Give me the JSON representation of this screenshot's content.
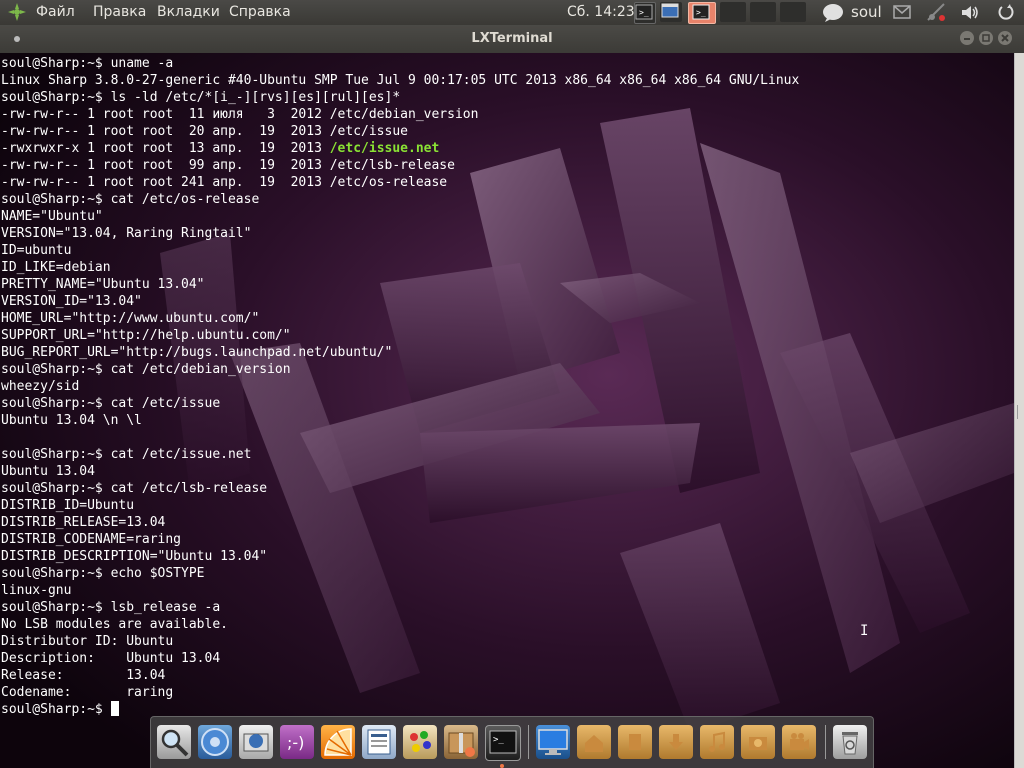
{
  "top_panel": {
    "menu": [
      "Файл",
      "Правка",
      "Вкладки",
      "Справка"
    ],
    "clock": "Сб. 14:23",
    "user": "soul"
  },
  "window": {
    "title": "LXTerminal"
  },
  "terminal": {
    "lines": [
      "soul@Sharp:~$ uname -a",
      "Linux Sharp 3.8.0-27-generic #40-Ubuntu SMP Tue Jul 9 00:17:05 UTC 2013 x86_64 x86_64 x86_64 GNU/Linux",
      "soul@Sharp:~$ ls -ld /etc/*[i_-][rvs][es][rul][es]*",
      "-rw-rw-r-- 1 root root  11 июля   3  2012 /etc/debian_version",
      "-rw-rw-r-- 1 root root  20 апр.  19  2013 /etc/issue",
      "-rwxrwxr-x 1 root root  13 апр.  19  2013 ",
      "-rw-rw-r-- 1 root root  99 апр.  19  2013 /etc/lsb-release",
      "-rw-rw-r-- 1 root root 241 апр.  19  2013 /etc/os-release",
      "soul@Sharp:~$ cat /etc/os-release",
      "NAME=\"Ubuntu\"",
      "VERSION=\"13.04, Raring Ringtail\"",
      "ID=ubuntu",
      "ID_LIKE=debian",
      "PRETTY_NAME=\"Ubuntu 13.04\"",
      "VERSION_ID=\"13.04\"",
      "HOME_URL=\"http://www.ubuntu.com/\"",
      "SUPPORT_URL=\"http://help.ubuntu.com/\"",
      "BUG_REPORT_URL=\"http://bugs.launchpad.net/ubuntu/\"",
      "soul@Sharp:~$ cat /etc/debian_version",
      "wheezy/sid",
      "soul@Sharp:~$ cat /etc/issue",
      "Ubuntu 13.04 \\n \\l",
      "",
      "soul@Sharp:~$ cat /etc/issue.net",
      "Ubuntu 13.04",
      "soul@Sharp:~$ cat /etc/lsb-release",
      "DISTRIB_ID=Ubuntu",
      "DISTRIB_RELEASE=13.04",
      "DISTRIB_CODENAME=raring",
      "DISTRIB_DESCRIPTION=\"Ubuntu 13.04\"",
      "soul@Sharp:~$ echo $OSTYPE",
      "linux-gnu",
      "soul@Sharp:~$ lsb_release -a",
      "No LSB modules are available.",
      "Distributor ID: Ubuntu",
      "Description:    Ubuntu 13.04",
      "Release:        13.04",
      "Codename:       raring",
      "soul@Sharp:~$ "
    ],
    "highlight_text": "/etc/issue.net",
    "highlight_color": "#8ae234"
  },
  "dock": {
    "icons": [
      "magnifier-icon",
      "chromium-icon",
      "mail-client-icon",
      "chat-icon",
      "orange-icon",
      "text-editor-icon",
      "paint-icon",
      "archive-manager-icon",
      "terminal-icon",
      "monitor-icon",
      "home-folder-icon",
      "documents-folder-icon",
      "downloads-folder-icon",
      "music-folder-icon",
      "pictures-folder-icon",
      "videos-folder-icon",
      "trash-icon"
    ]
  },
  "colors": {
    "panel": "#3c3b37",
    "terminal_bg": "#1a0818",
    "accent_orange": "#f07746"
  }
}
